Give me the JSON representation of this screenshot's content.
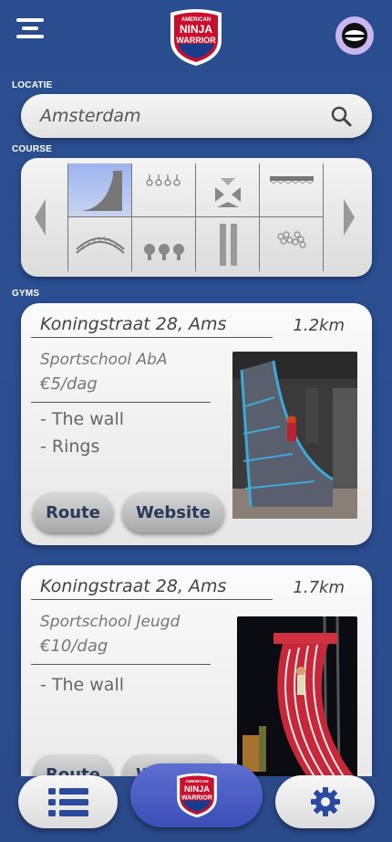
{
  "header": {
    "menu_icon": "hamburger-menu-icon",
    "logo_text_top": "AMERICAN",
    "logo_text_mid": "NINJA",
    "logo_text_bot": "WARRIOR",
    "avatar_icon": "ninja-avatar-icon"
  },
  "location": {
    "label": "LOCATIE",
    "value": "Amsterdam",
    "icon": "search-icon"
  },
  "course": {
    "label": "COURSE",
    "obstacles": [
      "warped-wall",
      "ring-toss",
      "floating-steps",
      "cliffhanger",
      "rope-bridge",
      "quintuple-steps",
      "pillars",
      "cannonball-alley"
    ],
    "selected_index": 0
  },
  "gyms": {
    "label": "GYMS",
    "items": [
      {
        "address": "Koningstraat 28, Ams",
        "distance": "1.2km",
        "name": "Sportschool AbA",
        "price": "€5/dag",
        "features": [
          "- The wall",
          "- Rings"
        ],
        "route_label": "Route",
        "website_label": "Website"
      },
      {
        "address": "Koningstraat 28, Ams",
        "distance": "1.7km",
        "name": "Sportschool Jeugd",
        "price": "€10/dag",
        "features": [
          "- The wall"
        ],
        "route_label": "Route",
        "website_label": "Website"
      }
    ]
  },
  "bottom_nav": {
    "left_icon": "list-icon",
    "center_icon": "ninja-warrior-logo-icon",
    "right_icon": "gear-icon"
  },
  "colors": {
    "background": "#2c4f92",
    "accent": "#3c4eb8",
    "selected_cell": "#9db4ef"
  }
}
